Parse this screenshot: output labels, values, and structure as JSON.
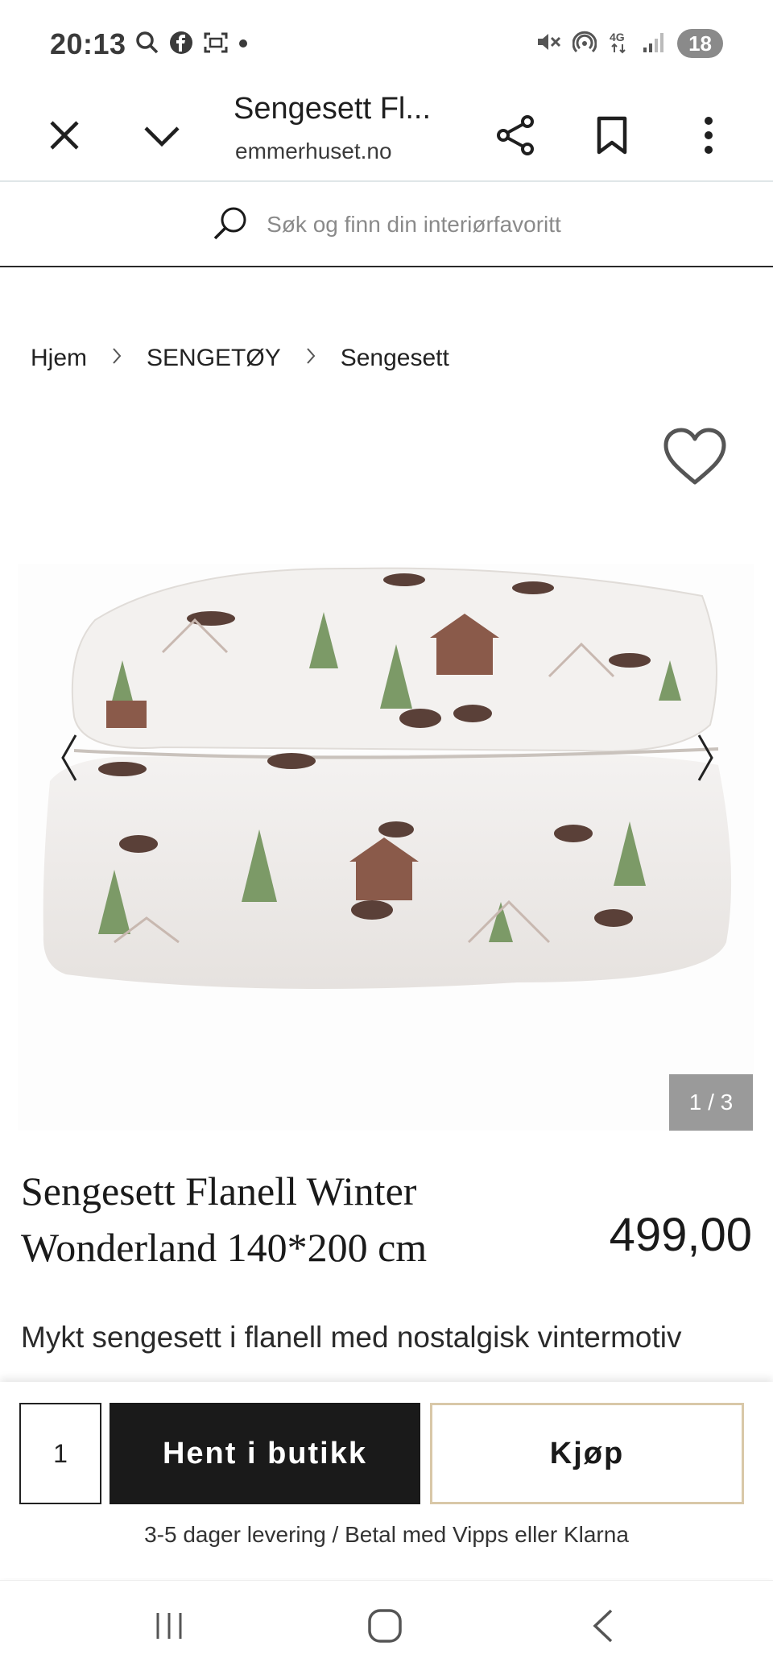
{
  "status_bar": {
    "time": "20:13",
    "battery": "18",
    "left_icons": [
      "search-icon",
      "facebook-icon",
      "screenshot-icon",
      "dot-icon"
    ],
    "right_icons": [
      "mute-icon",
      "hotspot-icon",
      "network-4g-icon",
      "signal-icon"
    ]
  },
  "browser": {
    "title": "Sengesett Fl...",
    "url": "emmerhuset.no",
    "icons": [
      "close-icon",
      "chevron-down-icon",
      "share-icon",
      "bookmark-icon",
      "more-icon"
    ]
  },
  "search": {
    "placeholder": "Søk og finn din interiørfavoritt"
  },
  "breadcrumb": {
    "items": [
      "Hjem",
      "SENGETØY",
      "Sengesett"
    ]
  },
  "gallery": {
    "counter": "1 / 3",
    "image_alt": "bedding-photo"
  },
  "product": {
    "title": "Sengesett Flanell Winter Wonderland 140*200 cm",
    "price": "499,00",
    "description": "Mykt sengesett i flanell med nostalgisk vintermotiv"
  },
  "purchase": {
    "quantity": "1",
    "store_button": "Hent i butikk",
    "buy_button": "Kjøp",
    "delivery_note": "3-5 dager levering / Betal med Vipps eller Klarna"
  },
  "colors": {
    "accent_border": "#d9c8a8",
    "dark_button": "#1a1a1a",
    "counter_bg": "#9a9a9a"
  }
}
